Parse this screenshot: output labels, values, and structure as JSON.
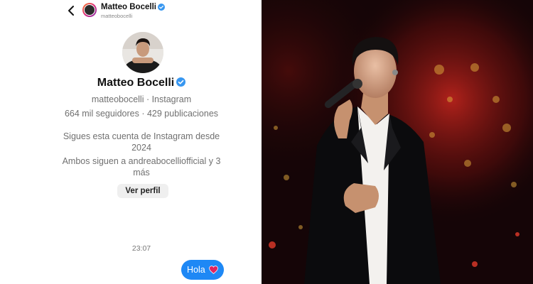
{
  "header": {
    "name": "Matteo Bocelli",
    "username": "matteobocelli"
  },
  "profile": {
    "name": "Matteo Bocelli",
    "handle_line": "matteobocelli · Instagram",
    "stats_line": "664 mil seguidores · 429 publicaciones",
    "following_since": "Sigues esta cuenta de Instagram desde 2024",
    "mutual_follow": "Ambos siguen a andreabocelliofficial y 3 más",
    "view_profile_label": "Ver perfil"
  },
  "messages": {
    "timestamp": "23:07",
    "sent_text": "Hola"
  },
  "colors": {
    "bubble": "#1e88f5",
    "verified": "#3897f0",
    "heart": "#e0245e"
  },
  "icons": {
    "back": "chevron-left-icon",
    "verified": "verified-badge-icon",
    "heart": "red-heart-icon"
  }
}
